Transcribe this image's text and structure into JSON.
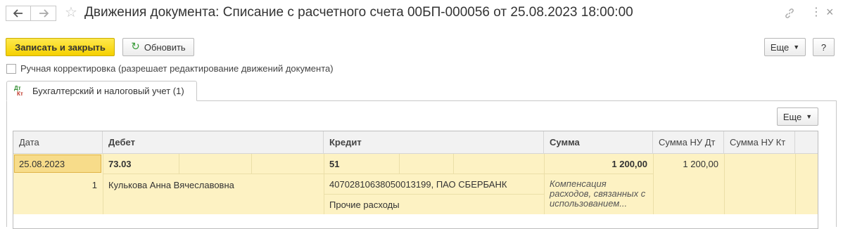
{
  "header": {
    "title": "Движения документа: Списание с расчетного счета 00БП-000056 от 25.08.2023 18:00:00",
    "star_glyph": "☆",
    "more_glyph": "⋮",
    "close_glyph": "×"
  },
  "toolbar": {
    "save_close_label": "Записать и закрыть",
    "refresh_label": "Обновить",
    "more_label": "Еще",
    "help_label": "?"
  },
  "manual_edit": {
    "label": "Ручная корректировка (разрешает редактирование движений документа)",
    "checked": false
  },
  "tabs": [
    {
      "label": "Бухгалтерский и налоговый учет (1)",
      "icon_top": "Дт",
      "icon_bottom": "Кт"
    }
  ],
  "table_toolbar": {
    "more_label": "Еще"
  },
  "table": {
    "columns": [
      "Дата",
      "Дебет",
      "Кредит",
      "Сумма",
      "Сумма НУ Дт",
      "Сумма НУ Кт"
    ],
    "rows": [
      {
        "date": "25.08.2023",
        "line_no": "1",
        "debit_account": "73.03",
        "debit_subconto": "Кулькова Анна Вячеславовна",
        "credit_account": "51",
        "credit_subconto1": "40702810638050013199, ПАО СБЕРБАНК",
        "credit_subconto2": "Прочие расходы",
        "amount": "1 200,00",
        "content": "Компенсация расходов, связанных с использованием...",
        "amount_nu_dt": "1 200,00",
        "amount_nu_kt": ""
      }
    ]
  },
  "colors": {
    "primary_button": "#f5d000",
    "selected_row": "#fdf2c3",
    "selected_cell": "#f7dc8a"
  }
}
